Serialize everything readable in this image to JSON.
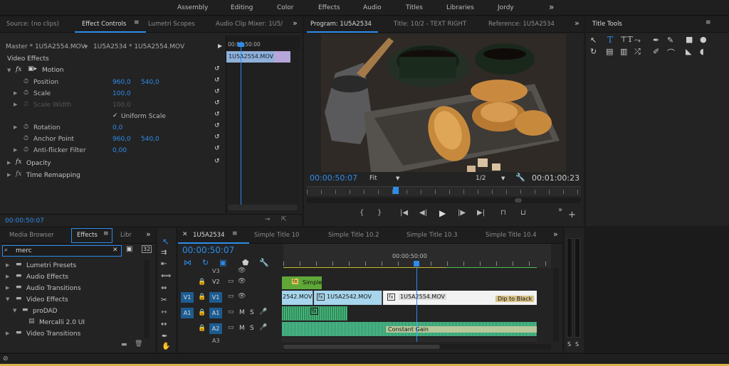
{
  "workspaces": [
    "Assembly",
    "Editing",
    "Color",
    "Effects",
    "Audio",
    "Titles",
    "Libraries",
    "Jordy"
  ],
  "workspace_more": "»",
  "effect_controls": {
    "tabs": [
      "Source: (no clips)",
      "Effect Controls",
      "Lumetri Scopes",
      "Audio Clip Mixer: 1U5/"
    ],
    "more": "»",
    "master_label": "Master * 1U5A2554.MOV",
    "clip_label": "1U5A2534 * 1U5A2554.MOV",
    "mini_time": "00:00:50:00",
    "mini_clip": "1U5A2554.MOV",
    "section": "Video Effects",
    "motion": "Motion",
    "rows": [
      {
        "name": "Position",
        "v1": "960,0",
        "v2": "540,0"
      },
      {
        "name": "Scale",
        "v1": "100,0",
        "v2": ""
      },
      {
        "name": "Scale Width",
        "v1": "100,0",
        "v2": ""
      },
      {
        "name": "Uniform Scale",
        "v1": "",
        "v2": ""
      },
      {
        "name": "Rotation",
        "v1": "0,0",
        "v2": ""
      },
      {
        "name": "Anchor Point",
        "v1": "960,0",
        "v2": "540,0"
      },
      {
        "name": "Anti-flicker Filter",
        "v1": "0,00",
        "v2": ""
      }
    ],
    "opacity": "Opacity",
    "time_remap": "Time Remapping",
    "timecode": "00:00:50:07"
  },
  "program": {
    "tabs": [
      "Program: 1U5A2534",
      "Title: 10/2 - TEXT RIGHT",
      "Reference: 1U5A2534"
    ],
    "more": "»",
    "timecode": "00:00:50:07",
    "fit": "Fit",
    "resolution": "1/2",
    "duration": "00:01:00:23",
    "playhead_fraction": 0.315
  },
  "title_tools": {
    "title": "Title Tools"
  },
  "media": {
    "tabs": [
      "Media Browser",
      "Effects",
      "Libr"
    ],
    "more": "»",
    "search": "merc",
    "tree": [
      {
        "label": "Lumetri Presets",
        "level": 0,
        "open": false
      },
      {
        "label": "Audio Effects",
        "level": 0,
        "open": false
      },
      {
        "label": "Audio Transitions",
        "level": 0,
        "open": false
      },
      {
        "label": "Video Effects",
        "level": 0,
        "open": true
      },
      {
        "label": "proDAD",
        "level": 1,
        "open": true
      },
      {
        "label": "Mercalli 2.0 UI",
        "level": 2,
        "open": false
      },
      {
        "label": "Video Transitions",
        "level": 0,
        "open": false
      }
    ]
  },
  "timeline": {
    "tabs": [
      "1U5A2534",
      "Simple Title 10",
      "Simple Title 10.2",
      "Simple Title 10.3",
      "Simple Title 10.4"
    ],
    "more": "»",
    "timecode": "00:00:50:07",
    "ruler_time": "00:00:50:00",
    "tracks": [
      {
        "name": "V3"
      },
      {
        "name": "V2"
      },
      {
        "name": "V1",
        "src": "V1"
      },
      {
        "name": "A1",
        "src": "A1"
      },
      {
        "name": "A2"
      },
      {
        "name": "A3"
      }
    ],
    "clips": {
      "v2_title": "Simple",
      "v1_a": "2542.MOV",
      "v1_b": "1U5A2542.MOV",
      "v1_c": "1U5A2554.MOV",
      "transition": "Dip to Black",
      "audio_label": "Constant Gain"
    }
  },
  "meter": {
    "labels": [
      "S",
      "S"
    ]
  },
  "colors": {
    "accent": "#2d8ceb",
    "clip_blue": "#a6d5ec",
    "audio_green": "#2f8c5a",
    "title_green": "#5fa838",
    "mini_clip": "#8fb0d9"
  }
}
